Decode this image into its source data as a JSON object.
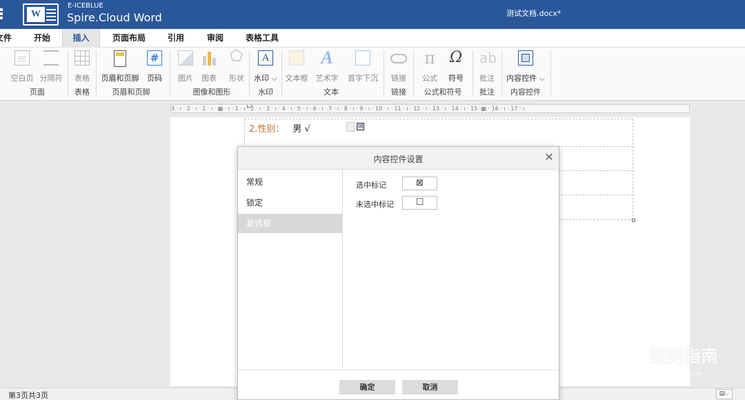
{
  "titlebar": {
    "brand_top": "E-ICEBLUE",
    "brand_name": "Spire.Cloud Word",
    "logo_letter": "W",
    "doc_title": "测试文档.docx*"
  },
  "tabs": [
    {
      "label": "文件"
    },
    {
      "label": "开始"
    },
    {
      "label": "插入"
    },
    {
      "label": "页面布局"
    },
    {
      "label": "引用"
    },
    {
      "label": "审阅"
    },
    {
      "label": "表格工具"
    }
  ],
  "active_tab": "插入",
  "ribbon": {
    "buttons": {
      "blank_page": "空白页",
      "page_break": "分隔符",
      "table": "表格",
      "header_footer": "页眉和页脚",
      "page_number": "页码",
      "picture": "图片",
      "chart": "图表",
      "shape": "形状",
      "watermark": "水印 ⌵",
      "textbox": "文本框",
      "wordart": "艺术字",
      "dropcap": "首字下沉",
      "link": "链接",
      "formula": "公式",
      "symbol": "符号",
      "comment": "批注",
      "content_control": "内容控件 ⌵"
    },
    "groups": {
      "page": "页面",
      "table": "表格",
      "header_footer": "页眉和页脚",
      "image_shape": "图像和图形",
      "watermark": "水印",
      "text": "文本",
      "link": "链接",
      "formula_symbol": "公式和符号",
      "comment": "批注",
      "content_control": "内容控件"
    },
    "icon_texts": {
      "page_number": "#",
      "watermark": "A",
      "wordart": "A",
      "formula": "π",
      "symbol": "Ω",
      "comment": "ab"
    }
  },
  "ruler": {
    "text": "3 · ı · 2 · ı · 1 · ı · ▦ · ı · 1 · ı · 2 · ı · 3 · ı · 4 · ı · 5 · ı · 6 · ı · 7 · ı · 8 · ı · 9 · ı · 10 · ı · 11 · ı · 12 · ı · 13 · ı · 14 · ı · 15 ·▦ · 16 · ı · 17 · ı"
  },
  "document": {
    "field_label": "2.性别：",
    "field_value": "男 √",
    "checkbox_mark": "☒"
  },
  "dialog": {
    "title": "内容控件设置",
    "close": "✕",
    "sidebar": [
      {
        "label": "常规",
        "active": false
      },
      {
        "label": "锁定",
        "active": false
      },
      {
        "label": "复选框",
        "active": true
      }
    ],
    "checked_label": "选中标记",
    "checked_symbol": "⊠",
    "unchecked_label": "未选中标记",
    "unchecked_symbol": "☐",
    "ok": "确定",
    "cancel": "取消"
  },
  "statusbar": {
    "pages": "第3页共3页",
    "view_icon": "▤⌵"
  },
  "watermark": {
    "logo": "S",
    "text": "搜狗指南",
    "url": "zhinan.sogou.com"
  },
  "colors": {
    "titlebar": "#2a579a",
    "active_tab_text": "#2a579a",
    "field_label": "#c0702a"
  }
}
